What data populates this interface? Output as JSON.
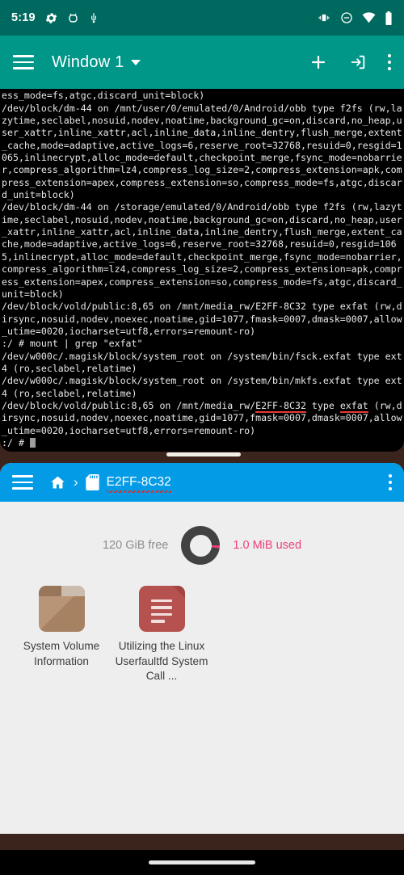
{
  "status_bar": {
    "time": "5:19",
    "left_icons": [
      "gear-icon",
      "bug-icon",
      "usb-icon"
    ],
    "right_icons": [
      "vibrate-icon",
      "do-not-disturb-icon",
      "wifi-icon",
      "battery-icon"
    ],
    "background": "#00695f"
  },
  "terminal_toolbar": {
    "menu_icon": "hamburger-icon",
    "window_title": "Window 1",
    "dropdown_icon": "chevron-down-icon",
    "add_icon": "plus-icon",
    "keyboard_icon": "arrow-into-box-icon",
    "overflow_icon": "more-vertical-icon",
    "background": "#009688"
  },
  "terminal": {
    "lines": [
      "press_extension=apk,compress_extension=apex,compress_extension=so,compress_mode=fs,atgc,discard_unit=block)",
      "/dev/block/dm-44 on /mnt/user/0/emulated/0/Android/obb type f2fs (rw,lazytime,seclabel,nosuid,nodev,noatime,background_gc=on,discard,no_heap,user_xattr,inline_xattr,acl,inline_data,inline_dentry,flush_merge,extent_cache,mode=adaptive,active_logs=6,reserve_root=32768,resuid=0,resgid=1065,inlinecrypt,alloc_mode=default,checkpoint_merge,fsync_mode=nobarrier,compress_algorithm=lz4,compress_log_size=2,compress_extension=apk,compress_extension=apex,compress_extension=so,compress_mode=fs,atgc,discard_unit=block)",
      "/dev/block/dm-44 on /storage/emulated/0/Android/obb type f2fs (rw,lazytime,seclabel,nosuid,nodev,noatime,background_gc=on,discard,no_heap,user_xattr,inline_xattr,acl,inline_data,inline_dentry,flush_merge,extent_cache,mode=adaptive,active_logs=6,reserve_root=32768,resuid=0,resgid=1065,inlinecrypt,alloc_mode=default,checkpoint_merge,fsync_mode=nobarrier,compress_algorithm=lz4,compress_log_size=2,compress_extension=apk,compress_extension=apex,compress_extension=so,compress_mode=fs,atgc,discard_unit=block)",
      "/dev/block/vold/public:8,65 on /mnt/media_rw/E2FF-8C32 type exfat (rw,dirsync,nosuid,nodev,noexec,noatime,gid=1077,fmask=0007,dmask=0007,allow_utime=0020,iocharset=utf8,errors=remount-ro)",
      ":/ # mount | grep \"exfat\"",
      "/dev/w000c/.magisk/block/system_root on /system/bin/fsck.exfat type ext4 (ro,seclabel,relatime)",
      "/dev/w000c/.magisk/block/system_root on /system/bin/mkfs.exfat type ext4 (ro,seclabel,relatime)"
    ],
    "last_mount_prefix": "/dev/block/vold/public:8,65 on /mnt/media_rw/",
    "last_mount_volume": "E2FF-8C32",
    "last_mount_mid": " type ",
    "last_mount_fstype": "exfat",
    "last_mount_suffix": " (rw,dirsync,nosuid,nodev,noexec,noatime,gid=1077,fmask=0007,dmask=0007,allow_utime=0020,iocharset=utf8,errors=remount-ro)",
    "prompt": ":/ # ",
    "background": "#000000",
    "foreground": "#e8e8e8"
  },
  "file_manager": {
    "menu_icon": "hamburger-icon",
    "home_icon": "home-icon",
    "separator_icon": "chevron-right-icon",
    "sdcard_icon": "sd-card-icon",
    "breadcrumb": "E2FF-8C32",
    "overflow_icon": "more-vertical-icon",
    "background": "#039be5",
    "storage": {
      "free_label": "120 GiB free",
      "used_label": "1.0 MiB used",
      "free_color": "#8d8d8d",
      "used_color": "#ec407a",
      "donut_color": "#424242"
    },
    "items": [
      {
        "name": "System Volume Information",
        "icon": "folder-icon",
        "type": "folder"
      },
      {
        "name": "Utilizing the Linux Userfaultfd System Call ...",
        "icon": "document-icon",
        "type": "file"
      }
    ]
  },
  "nav_bar": {
    "handle_icon": "gesture-pill",
    "background": "#000000"
  }
}
